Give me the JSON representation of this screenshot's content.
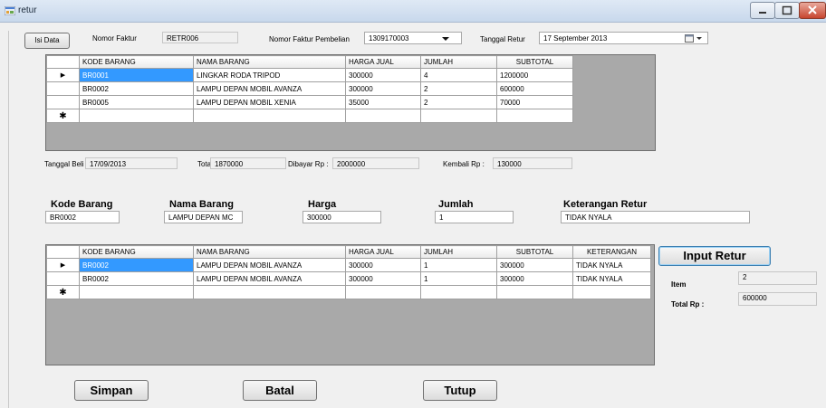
{
  "window": {
    "title": "retur"
  },
  "header": {
    "isi_data_label": "Isi Data",
    "nomor_faktur_label": "Nomor Faktur",
    "nomor_faktur_value": "RETR006",
    "nomor_faktur_pembelian_label": "Nomor Faktur Pembelian",
    "nomor_faktur_pembelian_value": "1309170003",
    "tanggal_retur_label": "Tanggal Retur",
    "tanggal_retur_value": "17 September 2013"
  },
  "purchase_grid": {
    "columns": [
      "KODE BARANG",
      "NAMA BARANG",
      "HARGA JUAL",
      "JUMLAH",
      "SUBTOTAL"
    ],
    "rows": [
      [
        "BR0001",
        "LINGKAR RODA TRIPOD",
        "300000",
        "4",
        "1200000"
      ],
      [
        "BR0002",
        "LAMPU DEPAN MOBIL AVANZA",
        "300000",
        "2",
        "600000"
      ],
      [
        "BR0005",
        "LAMPU DEPAN MOBIL XENIA",
        "35000",
        "2",
        "70000"
      ]
    ]
  },
  "summary": {
    "tanggal_beli_label": "Tanggal Beli",
    "tanggal_beli_value": "17/09/2013",
    "total_label": "Total",
    "total_value": "1870000",
    "dibayar_label": "Dibayar Rp :",
    "dibayar_value": "2000000",
    "kembali_label": "Kembali Rp :",
    "kembali_value": "130000"
  },
  "entry": {
    "kode_barang_label": "Kode Barang",
    "kode_barang_value": "BR0002",
    "nama_barang_label": "Nama Barang",
    "nama_barang_value": "LAMPU DEPAN MC",
    "harga_label": "Harga",
    "harga_value": "300000",
    "jumlah_label": "Jumlah",
    "jumlah_value": "1",
    "keterangan_label": "Keterangan Retur",
    "keterangan_value": "TIDAK NYALA"
  },
  "retur_grid": {
    "columns": [
      "KODE BARANG",
      "NAMA BARANG",
      "HARGA JUAL",
      "JUMLAH",
      "SUBTOTAL",
      "KETERANGAN"
    ],
    "rows": [
      [
        "BR0002",
        "LAMPU DEPAN MOBIL AVANZA",
        "300000",
        "1",
        "300000",
        "TIDAK NYALA"
      ],
      [
        "BR0002",
        "LAMPU DEPAN MOBIL AVANZA",
        "300000",
        "1",
        "300000",
        "TIDAK NYALA"
      ]
    ]
  },
  "side": {
    "input_retur_label": "Input Retur",
    "item_label": "Item",
    "item_value": "2",
    "total_rp_label": "Total Rp :",
    "total_rp_value": "600000"
  },
  "buttons": {
    "simpan": "Simpan",
    "batal": "Batal",
    "tutup": "Tutup"
  },
  "grid_markers": {
    "current_row": "▶",
    "new_row": "✱"
  },
  "colors": {
    "selection": "#3399ff",
    "grid_background": "#a9a9a9",
    "window_background": "#f0f0f0"
  }
}
